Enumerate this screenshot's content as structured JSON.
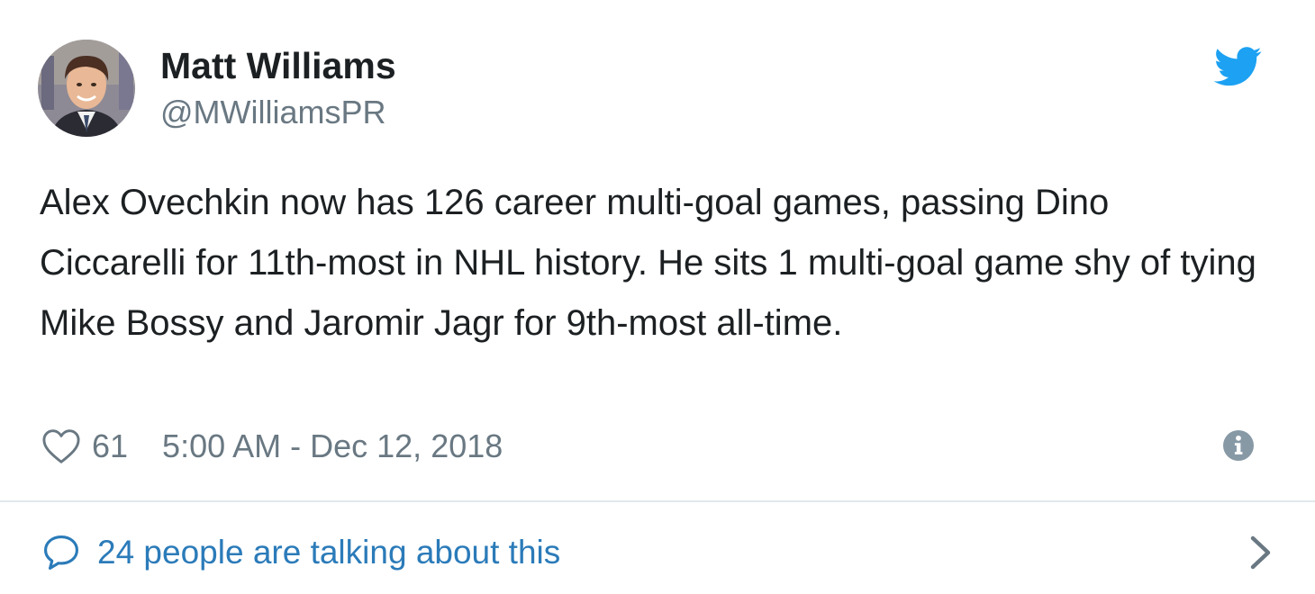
{
  "user": {
    "display_name": "Matt Williams",
    "handle": "@MWilliamsPR"
  },
  "tweet": {
    "text": "Alex Ovechkin now has 126 career multi-goal games, passing Dino Ciccarelli for 11th-most in NHL history. He sits 1 multi-goal game shy of tying Mike Bossy and Jaromir Jagr for 9th-most all-time.",
    "like_count": "61",
    "timestamp": "5:00 AM - Dec 12, 2018"
  },
  "conversation": {
    "label": "24 people are talking about this"
  },
  "icons": {
    "brand": "twitter-bird-icon",
    "like": "heart-icon",
    "info": "info-icon",
    "conversation": "speech-bubble-icon",
    "open": "chevron-right-icon"
  },
  "colors": {
    "brand": "#1da1f2",
    "link": "#2b7bb9",
    "text": "#1c2022",
    "secondary": "#697882",
    "divider": "#e1e8ed"
  }
}
